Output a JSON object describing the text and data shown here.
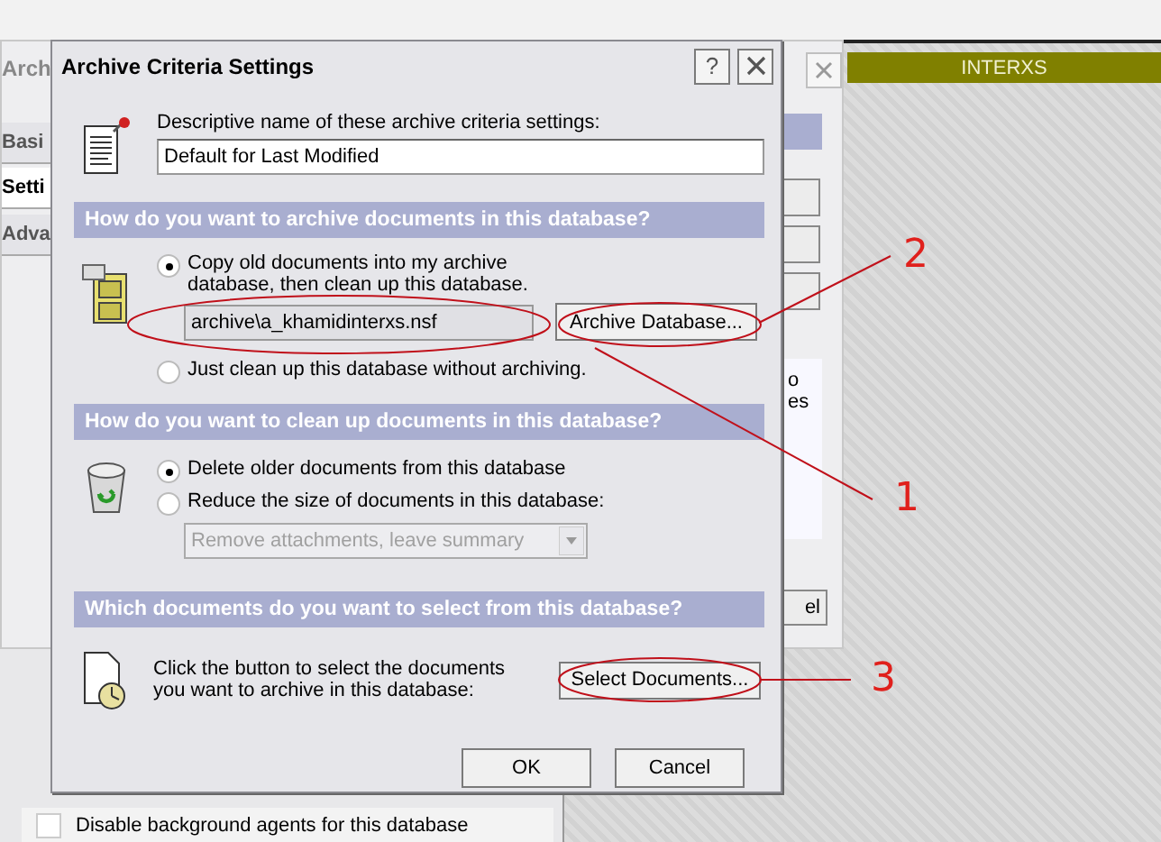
{
  "background_window": {
    "title": "Arch",
    "tabs": [
      {
        "label": "Basi",
        "selected": false
      },
      {
        "label": "Setti",
        "selected": true
      },
      {
        "label": "Adva",
        "selected": false
      }
    ],
    "text_fragments": [
      "o",
      "es"
    ],
    "button_fragment": "el",
    "checkbox": {
      "label": "Disable background agents for this database",
      "checked": false
    }
  },
  "banner": {
    "title": "INTERXS"
  },
  "dialog": {
    "title": "Archive Criteria Settings",
    "help": "?",
    "name_label": "Descriptive name of these archive criteria settings:",
    "name_value": "Default for Last Modified",
    "archive_section": {
      "heading": "How do you want to archive documents in this database?",
      "options": [
        {
          "label": "Copy old documents into my archive database, then clean up this database.",
          "selected": true
        },
        {
          "label": "Just clean up this database without archiving.",
          "selected": false
        }
      ],
      "path": "archive\\a_khamidinterxs.nsf",
      "button": "Archive Database..."
    },
    "cleanup_section": {
      "heading": "How do you want to clean up documents in this database?",
      "options": [
        {
          "label": "Delete older documents from this database",
          "selected": true
        },
        {
          "label": "Reduce the size of documents in this database:",
          "selected": false
        }
      ],
      "dropdown": {
        "value": "Remove attachments, leave summary",
        "disabled": true
      }
    },
    "select_section": {
      "heading": "Which documents do you want to select from this database?",
      "text": "Click the button to select the documents you want to archive in this database:",
      "button": "Select Documents..."
    },
    "buttons": [
      "OK",
      "Cancel"
    ]
  },
  "annotations": [
    {
      "label": "1"
    },
    {
      "label": "2"
    },
    {
      "label": "3"
    }
  ]
}
